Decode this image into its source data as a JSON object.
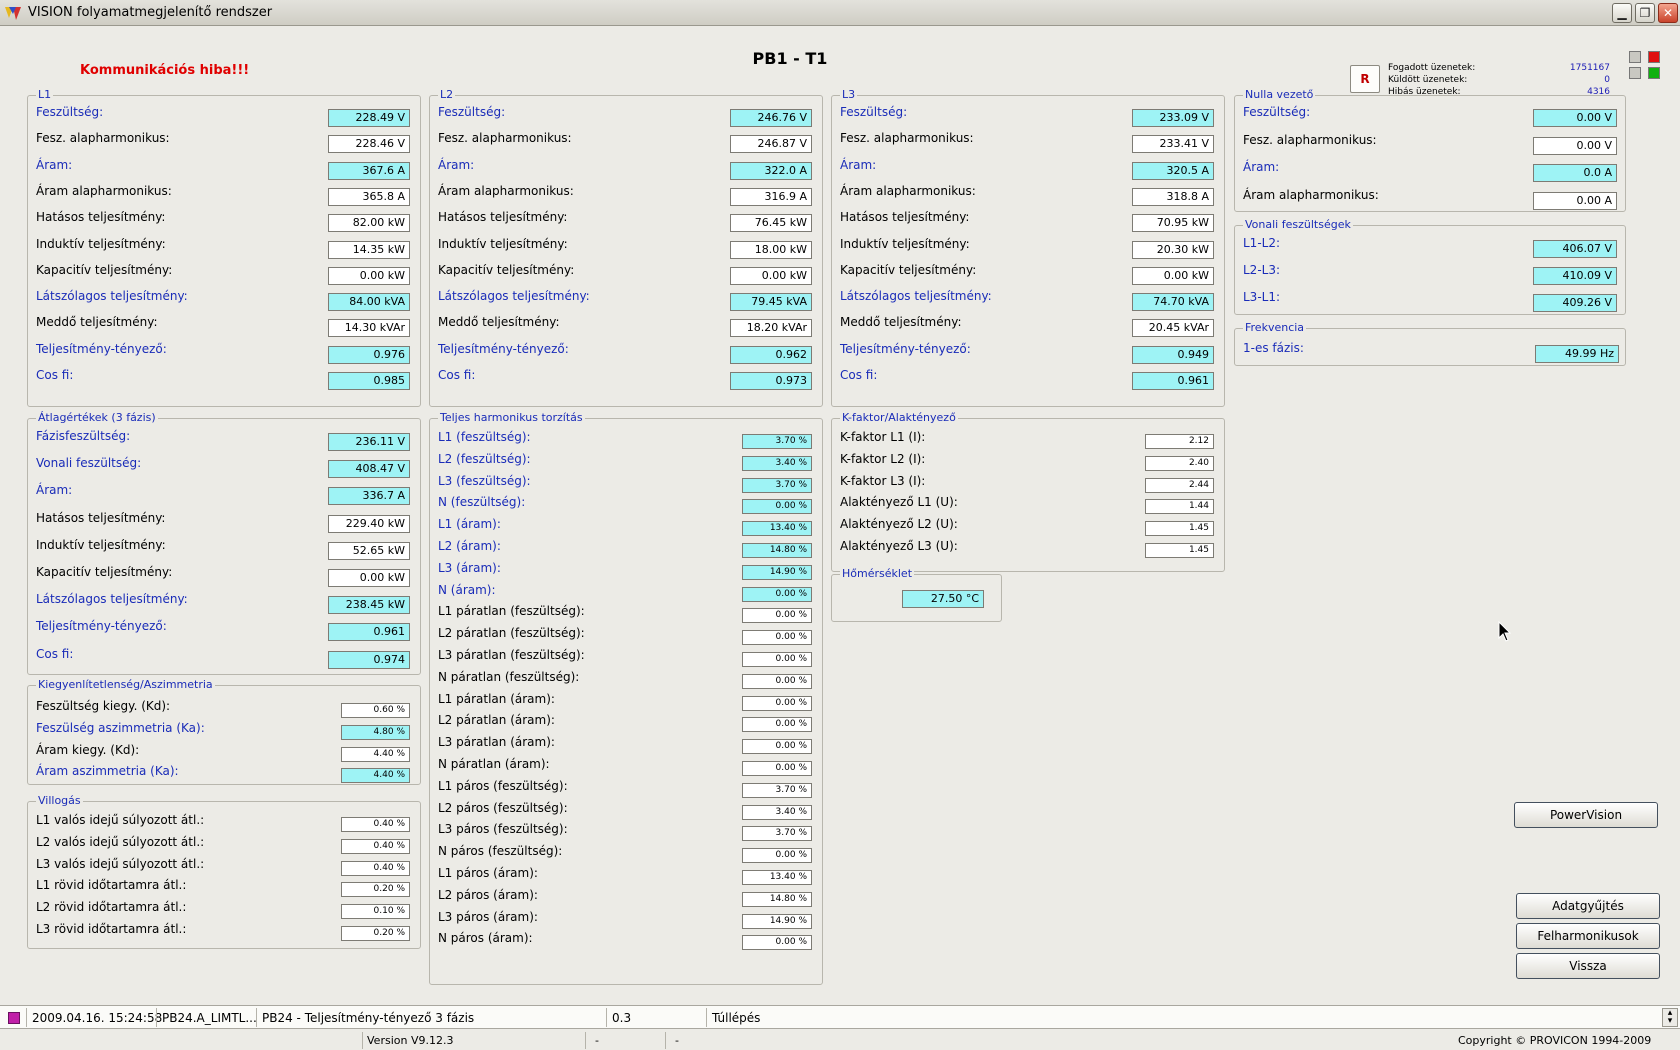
{
  "window": {
    "title": "VISION folyamatmegjelenítő rendszer"
  },
  "page_title": "PB1 - T1",
  "comm_error": "Kommunikációs hiba!!!",
  "stats": {
    "received_label": "Fogadott üzenetek:",
    "received_value": "1751167",
    "sent_label": "Küldött üzenetek:",
    "sent_value": "0",
    "error_label": "Hibás üzenetek:",
    "error_value": "4316",
    "reset_label": "R"
  },
  "colors": {
    "accent_blue": "#1a2cb8",
    "value_cyan": "#9ef3f5",
    "error_red": "#e00000",
    "lamp_red": "#e01010",
    "lamp_green": "#10b010",
    "lamp_gray": "#c9c8c2"
  },
  "l1": {
    "title": "L1",
    "rows": [
      {
        "label": "Feszültség:",
        "value": "228.49 V",
        "hl": true
      },
      {
        "label": "Fesz. alapharmonikus:",
        "value": "228.46 V",
        "hl": false
      },
      {
        "label": "Áram:",
        "value": "367.6 A",
        "hl": true
      },
      {
        "label": "Áram alapharmonikus:",
        "value": "365.8 A",
        "hl": false
      },
      {
        "label": "Hatásos teljesítmény:",
        "value": "82.00 kW",
        "hl": false
      },
      {
        "label": "Induktív teljesítmény:",
        "value": "14.35 kW",
        "hl": false
      },
      {
        "label": "Kapacitív teljesítmény:",
        "value": "0.00 kW",
        "hl": false
      },
      {
        "label": "Látszólagos teljesítmény:",
        "value": "84.00 kVA",
        "hl": true
      },
      {
        "label": "Meddő teljesítmény:",
        "value": "14.30 kVAr",
        "hl": false
      },
      {
        "label": "Teljesítmény-tényező:",
        "value": "0.976",
        "hl": true
      },
      {
        "label": "Cos fi:",
        "value": "0.985",
        "hl": true
      }
    ]
  },
  "l2": {
    "title": "L2",
    "rows": [
      {
        "label": "Feszültség:",
        "value": "246.76 V",
        "hl": true
      },
      {
        "label": "Fesz. alapharmonikus:",
        "value": "246.87 V",
        "hl": false
      },
      {
        "label": "Áram:",
        "value": "322.0 A",
        "hl": true
      },
      {
        "label": "Áram alapharmonikus:",
        "value": "316.9 A",
        "hl": false
      },
      {
        "label": "Hatásos teljesítmény:",
        "value": "76.45 kW",
        "hl": false
      },
      {
        "label": "Induktív teljesítmény:",
        "value": "18.00 kW",
        "hl": false
      },
      {
        "label": "Kapacitív teljesítmény:",
        "value": "0.00 kW",
        "hl": false
      },
      {
        "label": "Látszólagos teljesítmény:",
        "value": "79.45 kVA",
        "hl": true
      },
      {
        "label": "Meddő teljesítmény:",
        "value": "18.20 kVAr",
        "hl": false
      },
      {
        "label": "Teljesítmény-tényező:",
        "value": "0.962",
        "hl": true
      },
      {
        "label": "Cos fi:",
        "value": "0.973",
        "hl": true
      }
    ]
  },
  "l3": {
    "title": "L3",
    "rows": [
      {
        "label": "Feszültség:",
        "value": "233.09 V",
        "hl": true
      },
      {
        "label": "Fesz. alapharmonikus:",
        "value": "233.41 V",
        "hl": false
      },
      {
        "label": "Áram:",
        "value": "320.5 A",
        "hl": true
      },
      {
        "label": "Áram alapharmonikus:",
        "value": "318.8 A",
        "hl": false
      },
      {
        "label": "Hatásos teljesítmény:",
        "value": "70.95 kW",
        "hl": false
      },
      {
        "label": "Induktív teljesítmény:",
        "value": "20.30 kW",
        "hl": false
      },
      {
        "label": "Kapacitív teljesítmény:",
        "value": "0.00 kW",
        "hl": false
      },
      {
        "label": "Látszólagos teljesítmény:",
        "value": "74.70 kVA",
        "hl": true
      },
      {
        "label": "Meddő teljesítmény:",
        "value": "20.45 kVAr",
        "hl": false
      },
      {
        "label": "Teljesítmény-tényező:",
        "value": "0.949",
        "hl": true
      },
      {
        "label": "Cos fi:",
        "value": "0.961",
        "hl": true
      }
    ]
  },
  "neutral": {
    "title": "Nulla vezető",
    "rows": [
      {
        "label": "Feszültség:",
        "value": "0.00 V",
        "hl": true
      },
      {
        "label": "Fesz. alapharmonikus:",
        "value": "0.00 V",
        "hl": false
      },
      {
        "label": "Áram:",
        "value": "0.0 A",
        "hl": true
      },
      {
        "label": "Áram alapharmonikus:",
        "value": "0.00 A",
        "hl": false
      }
    ]
  },
  "line_voltages": {
    "title": "Vonali feszültségek",
    "rows": [
      {
        "label": "L1-L2:",
        "value": "406.07 V",
        "hl": true
      },
      {
        "label": "L2-L3:",
        "value": "410.09 V",
        "hl": true
      },
      {
        "label": "L3-L1:",
        "value": "409.26 V",
        "hl": true
      }
    ]
  },
  "frequency": {
    "title": "Frekvencia",
    "rows": [
      {
        "label": "1-es fázis:",
        "value": "49.99 Hz",
        "hl": true
      }
    ]
  },
  "averages": {
    "title": "Átlagértékek (3 fázis)",
    "rows": [
      {
        "label": "Fázisfeszültség:",
        "value": "236.11 V",
        "hl": true
      },
      {
        "label": "Vonali feszültség:",
        "value": "408.47 V",
        "hl": true
      },
      {
        "label": "Áram:",
        "value": "336.7 A",
        "hl": true
      },
      {
        "label": "Hatásos teljesítmény:",
        "value": "229.40 kW",
        "hl": false
      },
      {
        "label": "Induktív teljesítmény:",
        "value": "52.65 kW",
        "hl": false
      },
      {
        "label": "Kapacitív teljesítmény:",
        "value": "0.00 kW",
        "hl": false
      },
      {
        "label": "Látszólagos teljesítmény:",
        "value": "238.45 kW",
        "hl": true
      },
      {
        "label": "Teljesítmény-tényező:",
        "value": "0.961",
        "hl": true
      },
      {
        "label": "Cos fi:",
        "value": "0.974",
        "hl": true
      }
    ]
  },
  "asymmetry": {
    "title": "Kiegyenlítetlenség/Aszimmetria",
    "rows": [
      {
        "label": "Feszültség kiegy. (Kd):",
        "value": "0.60 %",
        "hl": false
      },
      {
        "label": "Feszülség aszimmetria (Ka):",
        "value": "4.80 %",
        "hl": true
      },
      {
        "label": "Áram kiegy. (Kd):",
        "value": "4.40 %",
        "hl": false
      },
      {
        "label": "Áram aszimmetria (Ka):",
        "value": "4.40 %",
        "hl": true
      }
    ]
  },
  "flicker": {
    "title": "Villogás",
    "rows": [
      {
        "label": "L1 valós idejű súlyozott átl.:",
        "value": "0.40 %",
        "hl": false
      },
      {
        "label": "L2 valós idejű súlyozott átl.:",
        "value": "0.40 %",
        "hl": false
      },
      {
        "label": "L3 valós idejű súlyozott átl.:",
        "value": "0.40 %",
        "hl": false
      },
      {
        "label": "L1 rövid időtartamra átl.:",
        "value": "0.20 %",
        "hl": false
      },
      {
        "label": "L2 rövid időtartamra átl.:",
        "value": "0.10 %",
        "hl": false
      },
      {
        "label": "L3 rövid időtartamra átl.:",
        "value": "0.20 %",
        "hl": false
      }
    ]
  },
  "thd": {
    "title": "Teljes harmonikus torzítás",
    "rows": [
      {
        "label": "L1 (feszültség):",
        "value": "3.70 %",
        "hl": true
      },
      {
        "label": "L2 (feszültség):",
        "value": "3.40 %",
        "hl": true
      },
      {
        "label": "L3 (feszültség):",
        "value": "3.70 %",
        "hl": true
      },
      {
        "label": "N (feszültség):",
        "value": "0.00 %",
        "hl": true
      },
      {
        "label": "L1 (áram):",
        "value": "13.40 %",
        "hl": true
      },
      {
        "label": "L2 (áram):",
        "value": "14.80 %",
        "hl": true
      },
      {
        "label": "L3 (áram):",
        "value": "14.90 %",
        "hl": true
      },
      {
        "label": "N (áram):",
        "value": "0.00 %",
        "hl": true
      },
      {
        "label": "L1 páratlan (feszültség):",
        "value": "0.00 %",
        "hl": false
      },
      {
        "label": "L2 páratlan (feszültség):",
        "value": "0.00 %",
        "hl": false
      },
      {
        "label": "L3 páratlan (feszültség):",
        "value": "0.00 %",
        "hl": false
      },
      {
        "label": "N páratlan (feszültség):",
        "value": "0.00 %",
        "hl": false
      },
      {
        "label": "L1 páratlan (áram):",
        "value": "0.00 %",
        "hl": false
      },
      {
        "label": "L2 páratlan (áram):",
        "value": "0.00 %",
        "hl": false
      },
      {
        "label": "L3 páratlan (áram):",
        "value": "0.00 %",
        "hl": false
      },
      {
        "label": "N páratlan (áram):",
        "value": "0.00 %",
        "hl": false
      },
      {
        "label": "L1 páros (feszültség):",
        "value": "3.70 %",
        "hl": false
      },
      {
        "label": "L2 páros (feszültség):",
        "value": "3.40 %",
        "hl": false
      },
      {
        "label": "L3 páros (feszültség):",
        "value": "3.70 %",
        "hl": false
      },
      {
        "label": "N páros (feszültség):",
        "value": "0.00 %",
        "hl": false
      },
      {
        "label": "L1 páros (áram):",
        "value": "13.40 %",
        "hl": false
      },
      {
        "label": "L2 páros (áram):",
        "value": "14.80 %",
        "hl": false
      },
      {
        "label": "L3 páros (áram):",
        "value": "14.90 %",
        "hl": false
      },
      {
        "label": "N páros (áram):",
        "value": "0.00 %",
        "hl": false
      }
    ]
  },
  "kfactor": {
    "title": "K-faktor/Alaktényező",
    "rows": [
      {
        "label": "K-faktor L1 (I):",
        "value": "2.12",
        "hl": false
      },
      {
        "label": "K-faktor L2 (I):",
        "value": "2.40",
        "hl": false
      },
      {
        "label": "K-faktor L3 (I):",
        "value": "2.44",
        "hl": false
      },
      {
        "label": "Alaktényező L1 (U):",
        "value": "1.44",
        "hl": false
      },
      {
        "label": "Alaktényező L2 (U):",
        "value": "1.45",
        "hl": false
      },
      {
        "label": "Alaktényező L3 (U):",
        "value": "1.45",
        "hl": false
      }
    ]
  },
  "temperature": {
    "title": "Hőmérséklet",
    "value": "27.50 °C"
  },
  "buttons": {
    "powervision": "PowerVision",
    "data_collection": "Adatgyűjtés",
    "harmonics": "Felharmonikusok",
    "back": "Vissza"
  },
  "event": {
    "datetime": "2009.04.16. 15:24:58",
    "tag": "PB24.A_LIMTL...",
    "description": "PB24 - Teljesítmény-tényező 3 fázis",
    "value": "0.3",
    "type": "Túllépés"
  },
  "footer": {
    "version": "Version V9.12.3",
    "dash1": "-",
    "dash2": "-",
    "copyright": "Copyright © PROVICON 1994-2009"
  }
}
